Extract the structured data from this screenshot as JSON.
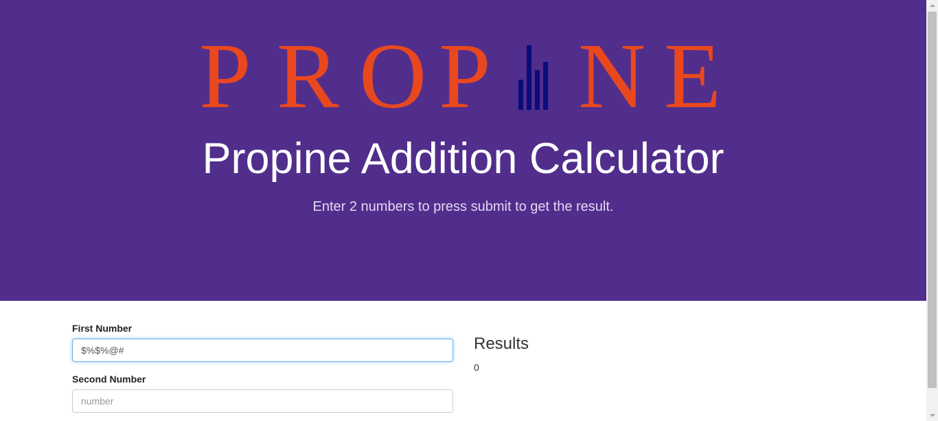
{
  "logo": {
    "letters": [
      "P",
      "R",
      "O",
      "P",
      "N",
      "E"
    ],
    "bars_icon": "bar-chart-icon",
    "letter_color": "#e9481f",
    "bars_color": "#0b0c7a"
  },
  "hero": {
    "title": "Propine Addition Calculator",
    "subtitle": "Enter 2 numbers to press submit to get the result.",
    "background": "#512e8c"
  },
  "form": {
    "first": {
      "label": "First Number",
      "value": "$%$%@#",
      "placeholder": "number"
    },
    "second": {
      "label": "Second Number",
      "value": "",
      "placeholder": "number"
    }
  },
  "results": {
    "title": "Results",
    "value": "0"
  }
}
